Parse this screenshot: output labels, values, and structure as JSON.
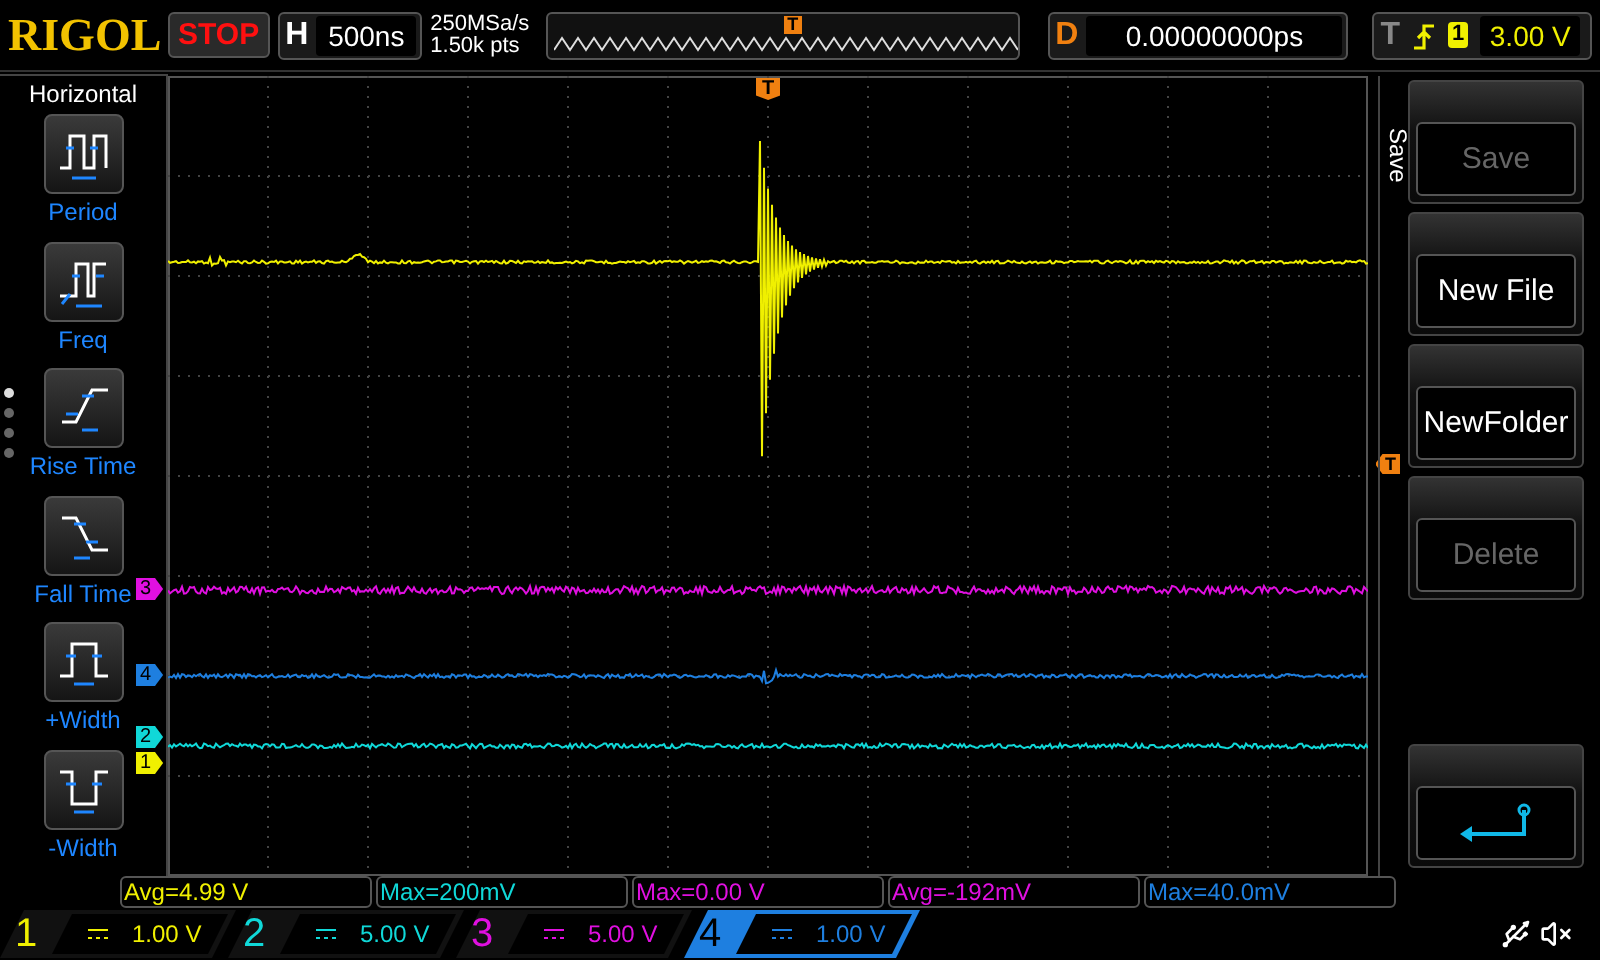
{
  "brand": "RIGOL",
  "run_state": "STOP",
  "horizontal": {
    "label": "H",
    "timebase": "500ns"
  },
  "acquisition": {
    "sample_rate": "250MSa/s",
    "memory_depth": "1.50k pts"
  },
  "overview": {
    "trigger_label": "T"
  },
  "delay": {
    "label": "D",
    "value": "0.00000000ps"
  },
  "trigger": {
    "label": "T",
    "channel": "1",
    "level": "3.00 V"
  },
  "left_menu": {
    "title": "Horizontal",
    "items": [
      {
        "kind": "period",
        "label": "Period"
      },
      {
        "kind": "freq",
        "label": "Freq"
      },
      {
        "kind": "rise",
        "label": "Rise Time"
      },
      {
        "kind": "fall",
        "label": "Fall Time"
      },
      {
        "kind": "pwidth",
        "label": "+Width"
      },
      {
        "kind": "nwidth",
        "label": "-Width"
      }
    ],
    "page_dots": [
      {
        "selected": true
      },
      {
        "selected": false
      },
      {
        "selected": false
      },
      {
        "selected": false
      }
    ]
  },
  "grid": {
    "trigger_position_label": "T",
    "trigger_level_label": "T",
    "markers": [
      {
        "label": "3",
        "color": "#e010e0"
      },
      {
        "label": "4",
        "color": "#1e7fe0"
      },
      {
        "label": "2",
        "color": "#10d8d8"
      },
      {
        "label": "1",
        "color": "#f0f000"
      }
    ]
  },
  "right_menu": {
    "title": "Save",
    "softkeys": [
      {
        "kind": "text",
        "label": "Save",
        "disabled": true
      },
      {
        "kind": "text",
        "label": "New File",
        "disabled": false
      },
      {
        "kind": "text",
        "label": "NewFolder",
        "disabled": false
      },
      {
        "kind": "text",
        "label": "Delete",
        "disabled": true
      },
      {
        "kind": "back"
      }
    ]
  },
  "measurements": [
    {
      "text": "Avg=4.99 V",
      "color": "#f0f000"
    },
    {
      "text": "Max=200mV",
      "color": "#10d8d8"
    },
    {
      "text": "Max=0.00 V",
      "color": "#e010e0"
    },
    {
      "text": "Avg=-192mV",
      "color": "#e010e0"
    },
    {
      "text": "Max=40.0mV",
      "color": "#1e7fe0"
    }
  ],
  "channels": [
    {
      "number": "1",
      "scale": "1.00 V",
      "color": "#f0f000",
      "selected": false
    },
    {
      "number": "2",
      "scale": "5.00 V",
      "color": "#10d8d8",
      "selected": false
    },
    {
      "number": "3",
      "scale": "5.00 V",
      "color": "#e010e0",
      "selected": false
    },
    {
      "number": "4",
      "scale": "1.00 V",
      "color": "#1e7fe0",
      "selected": true
    }
  ]
}
